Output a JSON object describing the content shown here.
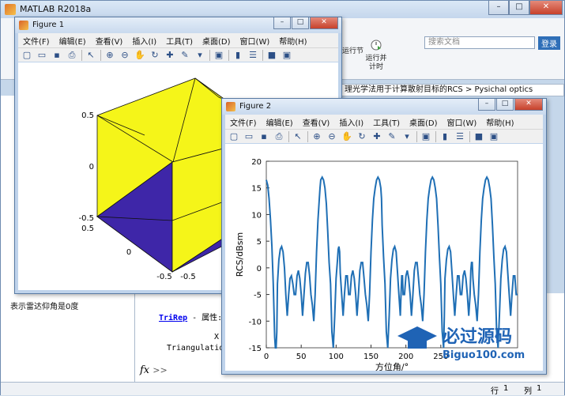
{
  "app": {
    "title": "MATLAB R2018a",
    "search_placeholder": "搜索文档",
    "signin_label": "登录",
    "ribbon": {
      "run_section_label": "运行节",
      "run_time_label": "运行并计时"
    },
    "current_folder": "理光学法用于计算散射目标的RCS > Pysichal optics",
    "left_note": "表示雷达仰角是0度",
    "command": {
      "trirep_link": "TriRep",
      "trirep_text": " - 属性:",
      "line2": "X",
      "line3": "Triangulation",
      "prompt": "fx",
      "prompt_arrows": ">>"
    },
    "status": {
      "row_label": "行",
      "row_value": "1",
      "col_label": "列",
      "col_value": "1"
    }
  },
  "figure1": {
    "title": "Figure 1",
    "menu": [
      "文件(F)",
      "编辑(E)",
      "查看(V)",
      "插入(I)",
      "工具(T)",
      "桌面(D)",
      "窗口(W)",
      "帮助(H)"
    ],
    "ticks": {
      "z": [
        "0.5",
        "0",
        "-0.5"
      ],
      "y": [
        "0.5",
        "0",
        "-0.5"
      ],
      "x": [
        "-0.5"
      ]
    },
    "colors": {
      "yellow": "#f5f519",
      "blue": "#3e26a8"
    }
  },
  "figure2": {
    "title": "Figure 2",
    "menu": [
      "文件(F)",
      "编辑(E)",
      "查看(V)",
      "插入(I)",
      "工具(T)",
      "桌面(D)",
      "窗口(W)",
      "帮助(H)"
    ],
    "chart_data": {
      "type": "line",
      "xlabel": "方位角/°",
      "ylabel": "RCS/dBsm",
      "xlim": [
        0,
        360
      ],
      "ylim": [
        -15,
        20
      ],
      "xticks": [
        0,
        50,
        100,
        150,
        200,
        250
      ],
      "yticks": [
        20,
        15,
        10,
        5,
        0,
        -5,
        -10,
        -15
      ],
      "line_color": "#1f6fb5",
      "series": [
        {
          "x": [
            0,
            2,
            4,
            6,
            8,
            10,
            12,
            13,
            14,
            15,
            16,
            18,
            20,
            22,
            24,
            26,
            28,
            30,
            32,
            34,
            36,
            38,
            40,
            42,
            44,
            46,
            48,
            50,
            52,
            54,
            56,
            58,
            60,
            62,
            64,
            66,
            68,
            70,
            72,
            74,
            76,
            77,
            78,
            80,
            82,
            84,
            86,
            88,
            90,
            92,
            94,
            96,
            98,
            100,
            102,
            103,
            104,
            105,
            106,
            108,
            110,
            112,
            114,
            116,
            118,
            120,
            122,
            124,
            126,
            128,
            130,
            132,
            134,
            136,
            138,
            140,
            142,
            144,
            146,
            148,
            150,
            152,
            154,
            156,
            158,
            160,
            162,
            164,
            165,
            166,
            168,
            170,
            172,
            174,
            176,
            178,
            180,
            182,
            184,
            186,
            188,
            190,
            192,
            193,
            194,
            195,
            196,
            198,
            200,
            202,
            204,
            206,
            208,
            210,
            212,
            214,
            216,
            218,
            220,
            222,
            224,
            226,
            228,
            230,
            232,
            234,
            236,
            238,
            240,
            242,
            244,
            246,
            248,
            250,
            252,
            254,
            255,
            256,
            258,
            260,
            262,
            264,
            266,
            268,
            270,
            272,
            274,
            276,
            278,
            280,
            282,
            284,
            286,
            288,
            290,
            292,
            293,
            294,
            295,
            296,
            298,
            300,
            302,
            304,
            306,
            308,
            310,
            312,
            314,
            316,
            318,
            320,
            322,
            324,
            326,
            328,
            330,
            332,
            334,
            336,
            338,
            340,
            342,
            344,
            346,
            348,
            350,
            352,
            354,
            356,
            358,
            360
          ],
          "y": [
            16.5,
            15.5,
            13,
            9,
            4,
            -3,
            -13,
            -15,
            -15,
            -12,
            -3,
            1.5,
            3.5,
            4,
            3,
            0,
            -5,
            -9,
            -5,
            -2,
            -1.5,
            -3,
            -5,
            -5,
            -1.5,
            -0.5,
            -2,
            -5,
            -9,
            -5,
            -1,
            1,
            1,
            -1.5,
            -5,
            -7,
            -10,
            -5,
            3,
            9,
            13,
            15,
            16.5,
            17,
            16.5,
            15,
            12,
            7,
            1,
            -3,
            -12,
            -15,
            -9,
            -2,
            1.5,
            3.5,
            4,
            3,
            -1,
            -5,
            -9,
            -5,
            -1.5,
            -1.5,
            -5,
            -5,
            -1.5,
            -0.5,
            -2,
            -5,
            -9,
            -5,
            -0.5,
            1,
            1,
            -2,
            -5,
            -7,
            -10,
            -5,
            3,
            9,
            13,
            15,
            16.5,
            17,
            16.5,
            15,
            13,
            8,
            2,
            -3,
            -12,
            -15,
            -9,
            -2,
            1.5,
            3.5,
            4,
            3,
            -1,
            -5,
            -9,
            -5,
            -1.5,
            -1.5,
            -5,
            -5,
            -1.5,
            -0.5,
            -2,
            -5,
            -9,
            -5,
            -0.5,
            1,
            1,
            -2,
            -5,
            -7,
            -10,
            -5,
            3,
            9,
            13,
            15,
            16.5,
            17,
            16.5,
            15,
            13,
            8,
            2,
            -3,
            -12,
            -15,
            -9,
            -2,
            1.5,
            3.5,
            4,
            3,
            -1,
            -5,
            -9,
            -5,
            -1.5,
            -1.5,
            -5,
            -5,
            -1.5,
            -0.5,
            -2,
            -5,
            -9,
            -5,
            -0.5,
            1,
            1,
            -2,
            -5,
            -7,
            -10,
            -5,
            3,
            9,
            13,
            15,
            16.5,
            17,
            16.5,
            15,
            13,
            8,
            2,
            -3,
            -12,
            -15,
            -9,
            -2,
            1.5,
            3.5,
            4,
            3,
            -1,
            -5,
            -9,
            -5,
            -1.5,
            -1.5,
            -5,
            -5,
            -1.5,
            -0.5,
            -2,
            -5,
            -9,
            -5,
            -0.5,
            1,
            1,
            -2,
            -5,
            -7,
            -10,
            -5,
            3,
            17
          ]
        }
      ]
    }
  },
  "watermark": {
    "title": "必过源码",
    "url": "Biguo100.com"
  }
}
